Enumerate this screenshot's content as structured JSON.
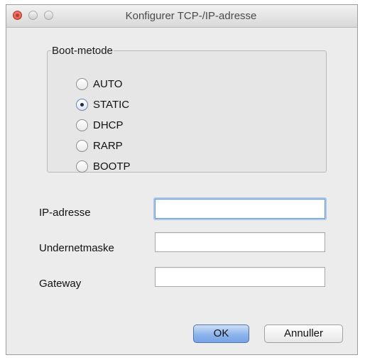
{
  "window": {
    "title": "Konfigurer TCP-/IP-adresse"
  },
  "boot_method": {
    "legend": "Boot-metode",
    "options": [
      {
        "label": "AUTO",
        "selected": false
      },
      {
        "label": "STATIC",
        "selected": true
      },
      {
        "label": "DHCP",
        "selected": false
      },
      {
        "label": "RARP",
        "selected": false
      },
      {
        "label": "BOOTP",
        "selected": false
      }
    ]
  },
  "fields": {
    "ip_address": {
      "label": "IP-adresse",
      "value": ""
    },
    "subnet_mask": {
      "label": "Undernetmaske",
      "value": ""
    },
    "gateway": {
      "label": "Gateway",
      "value": ""
    }
  },
  "buttons": {
    "ok": "OK",
    "cancel": "Annuller"
  }
}
